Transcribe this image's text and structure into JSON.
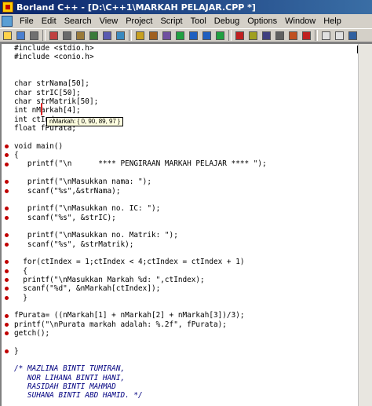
{
  "window": {
    "title": "Borland C++ - [D:\\C++1\\MARKAH PELAJAR.CPP *]"
  },
  "menubar": {
    "items": [
      "File",
      "Edit",
      "Search",
      "View",
      "Project",
      "Script",
      "Tool",
      "Debug",
      "Options",
      "Window",
      "Help"
    ]
  },
  "toolbar": {
    "icons": [
      "open-file-icon",
      "save-icon",
      "print-icon",
      "cut-icon",
      "copy-icon",
      "paste-icon",
      "find-icon",
      "replace-icon",
      "search-next-icon",
      "compile-icon",
      "make-icon",
      "build-icon",
      "run-icon",
      "step-over-icon",
      "trace-into-icon",
      "run-to-cursor-icon",
      "toggle-breakpoint-icon",
      "add-watch-icon",
      "evaluate-icon",
      "inspect-icon",
      "debug-icon",
      "terminate-icon",
      "tile-icon",
      "cascade-icon",
      "help-icon"
    ]
  },
  "editor": {
    "lines": [
      "#include <stdio.h>",
      "#include <conio.h>",
      "",
      "",
      "char strNama[50];",
      "char strIC[50];",
      "char strMatrik[50];",
      "int nMarkah[4];",
      "int ctIndex;",
      "float fPurata;",
      "",
      "void main()",
      "{",
      "   printf(\"\\n      **** PENGIRAAN MARKAH PELAJAR **** \");",
      "",
      "   printf(\"\\nMasukkan nama: \");",
      "   scanf(\"%s\",&strNama);",
      "",
      "   printf(\"\\nMasukkan no. IC: \");",
      "   scanf(\"%s\", &strIC);",
      "",
      "   printf(\"\\nMasukkan no. Matrik: \");",
      "   scanf(\"%s\", &strMatrik);",
      "",
      "  for(ctIndex = 1;ctIndex < 4;ctIndex = ctIndex + 1)",
      "  {",
      "  printf(\"\\nMasukkan Markah %d: \",ctIndex);",
      "  scanf(\"%d\", &nMarkah[ctIndex]);",
      "  }",
      "",
      "fPurata= ((nMarkah[1] + nMarkah[2] + nMarkah[3])/3);",
      "printf(\"\\nPurata markah adalah: %.2f\", fPurata);",
      "getch();",
      "",
      "}",
      "",
      "/* MAZLINA BINTI TUMIRAN,",
      "   NOR LIHANA BINTI HANI,",
      "   RASIDAH BINTI MAHMAD",
      "   SUHANA BINTI ABD HAMID. */"
    ],
    "breakpoint_lines": [
      11,
      12,
      13,
      15,
      16,
      18,
      19,
      21,
      22,
      24,
      25,
      26,
      27,
      28,
      30,
      31,
      32,
      34
    ],
    "comment_lines": [
      36,
      37,
      38,
      39
    ]
  },
  "tooltip": {
    "text": "nMarkah: { 0, 90, 89, 97 }"
  },
  "colors": {
    "titlebar_start": "#0a246a",
    "titlebar_end": "#3a6ea5",
    "breakpoint": "#c00000",
    "comment": "#000080",
    "tooltip_bg": "#ffffe1"
  }
}
